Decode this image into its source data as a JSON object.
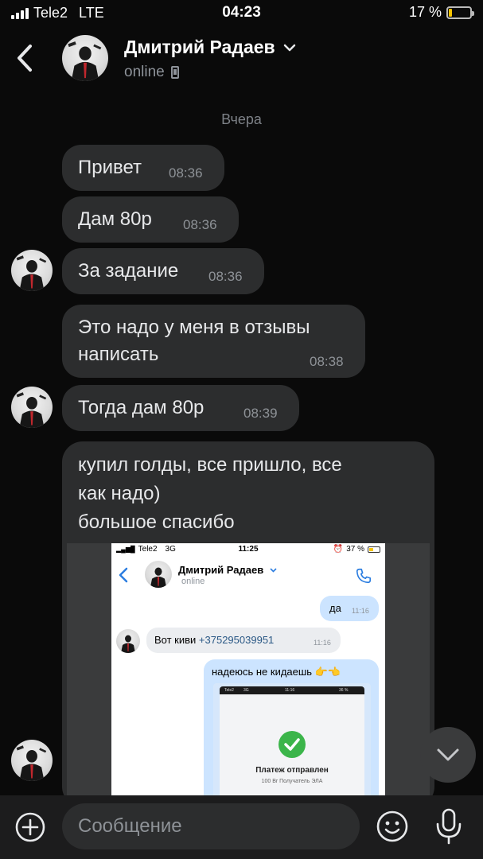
{
  "status_bar": {
    "carrier": "Tele2",
    "network": "LTE",
    "time": "04:23",
    "battery": "17 %",
    "battery_level": 0.17
  },
  "header": {
    "back_icon": "chevron-left-icon",
    "name": "Дмитрий Радаев",
    "status": "online"
  },
  "date_separator": "Вчера",
  "messages": [
    {
      "text": "Привет",
      "time": "08:36"
    },
    {
      "text": "Дам 80р",
      "time": "08:36"
    },
    {
      "text": "За задание",
      "time": "08:36"
    },
    {
      "text_lines": [
        "Это надо у меня в отзывы",
        "написать"
      ],
      "time": "08:38"
    },
    {
      "text": "Тогда дам 80р",
      "time": "08:39"
    },
    {
      "text_lines": [
        "купил голды, все пришло, все",
        "как надо)",
        "большое спасибо"
      ]
    }
  ],
  "attachment": {
    "status_bar": {
      "carrier": "Tele2",
      "network": "3G",
      "time": "11:25",
      "battery": "37 %"
    },
    "header": {
      "name": "Дмитрий Радаев",
      "status": "online"
    },
    "messages": [
      {
        "text": "да",
        "time": "11:16"
      },
      {
        "text": "Вот киви ",
        "link": "+375295039951",
        "time": "11:16"
      },
      {
        "text": "надеюсь не кидаешь 👉👈"
      }
    ],
    "inner_screenshot": {
      "status_bar": {
        "carrier": "Tele2",
        "network": "3G",
        "time": "11:16",
        "battery": "36 %"
      },
      "title": "Платеж отправлен",
      "subtitle": "100 Br Получатель ЭЛА"
    }
  },
  "composer": {
    "placeholder": "Сообщение"
  }
}
